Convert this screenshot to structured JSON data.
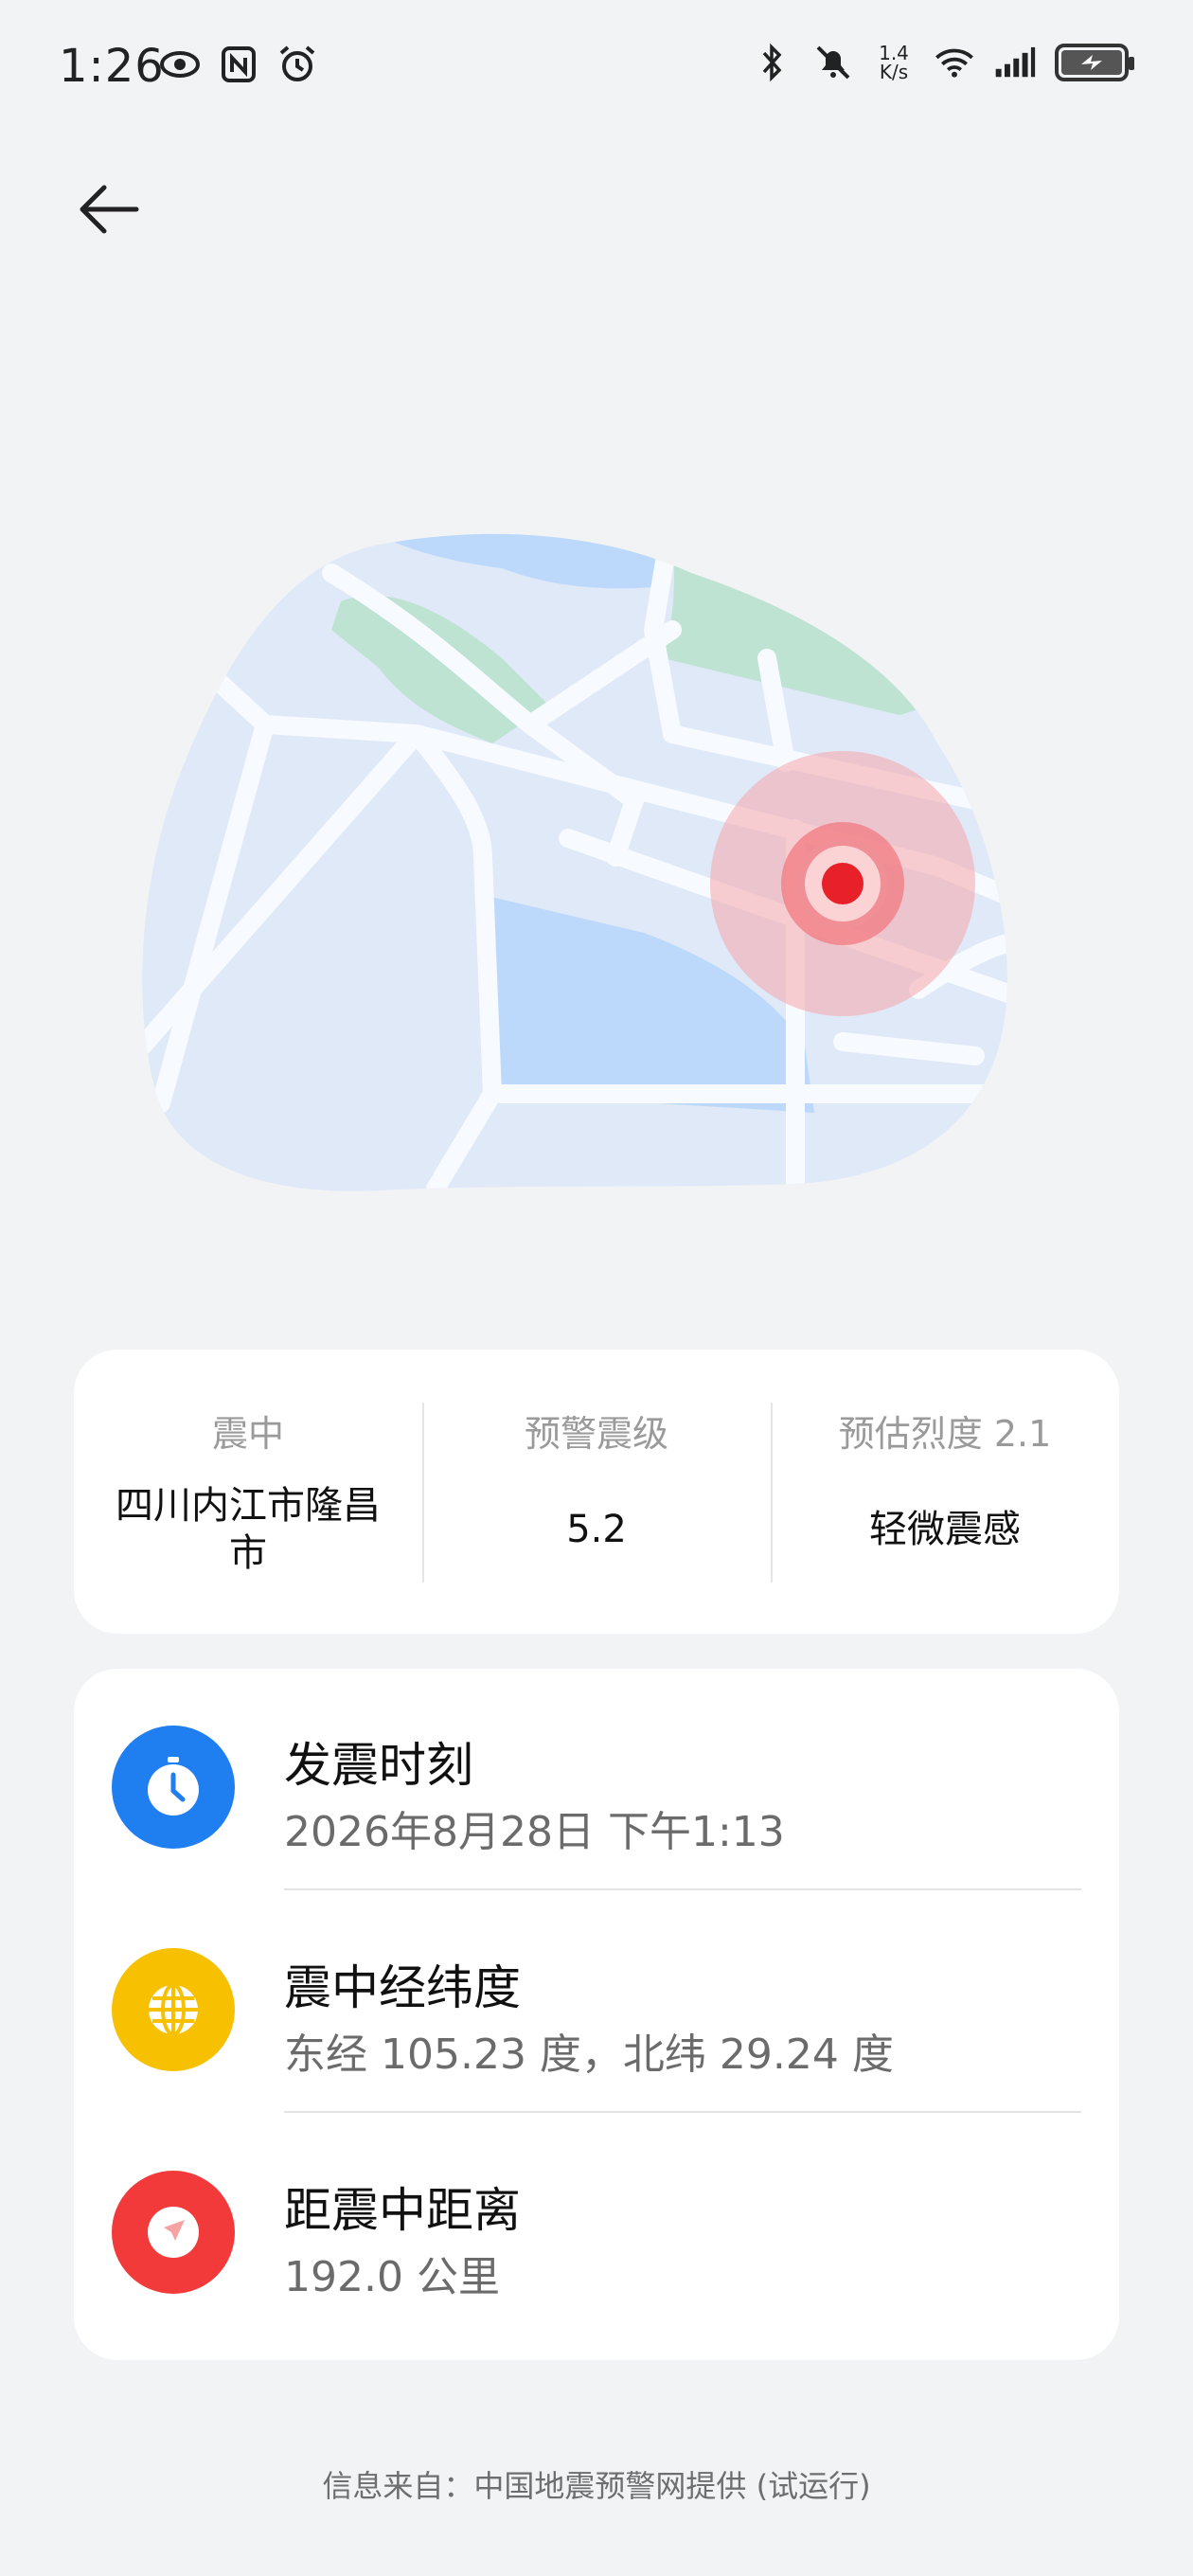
{
  "status_bar": {
    "time": "1:26",
    "network_speed_top": "1.4",
    "network_speed_bottom": "K/s",
    "icons_left": [
      "eye-icon",
      "nfc-icon",
      "alarm-icon"
    ],
    "icons_right": [
      "bluetooth-icon",
      "mute-icon",
      "wifi-icon",
      "signal-icon",
      "battery-charging-icon"
    ]
  },
  "summary": {
    "epicenter_label": "震中",
    "epicenter_value": "四川内江市隆昌市",
    "magnitude_label": "预警震级",
    "magnitude_value": "5.2",
    "intensity_label": "预估烈度 2.1",
    "intensity_value": "轻微震感"
  },
  "details": [
    {
      "title": "发震时刻",
      "value": "2026年8月28日 下午1:13",
      "icon": "clock-icon",
      "color": "#1f7ef0"
    },
    {
      "title": "震中经纬度",
      "value": "东经 105.23 度，北纬 29.24 度",
      "icon": "globe-icon",
      "color": "#f7c000"
    },
    {
      "title": "距震中距离",
      "value": "192.0 公里",
      "icon": "navigation-arrow-icon",
      "color": "#f23a3a"
    }
  ],
  "footer": {
    "text": "信息来自：中国地震预警网提供 (试运行)"
  },
  "colors": {
    "background": "#f1f3f5",
    "map_land": "#dfe9f8",
    "map_water": "#bcd9fb",
    "map_park": "#bfe3d2",
    "epicenter_red": "#e8202a"
  }
}
